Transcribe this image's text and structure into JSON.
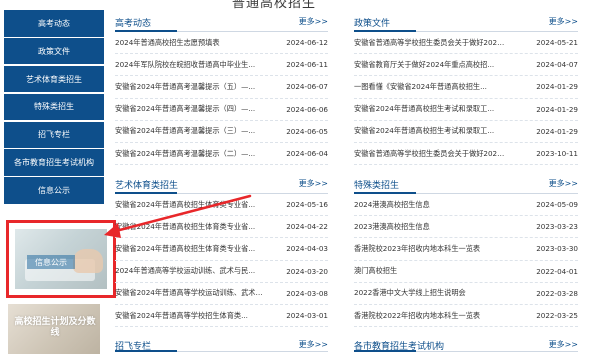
{
  "page_title": "普通高校招生",
  "sidebar": {
    "items": [
      {
        "label": "高考动态"
      },
      {
        "label": "政策文件"
      },
      {
        "label": "艺术体育类招生"
      },
      {
        "label": "特殊类招生"
      },
      {
        "label": "招飞专栏"
      },
      {
        "label": "各市教育招生考试机构"
      },
      {
        "label": "信息公示"
      }
    ],
    "promo1_label": "信息公示",
    "promo2_label": "高校招生计划及分数线"
  },
  "more_label": "更多>>",
  "sections": {
    "gaokao": {
      "title": "高考动态",
      "rows": [
        {
          "title": "2024年普通高校招生志愿预填表",
          "date": "2024-06-12"
        },
        {
          "title": "2024年军队院校在皖招收普通高中毕业生...",
          "date": "2024-06-11"
        },
        {
          "title": "安徽省2024年普通高考温馨提示（五）—...",
          "date": "2024-06-07"
        },
        {
          "title": "安徽省2024年普通高考温馨提示（四）—...",
          "date": "2024-06-06"
        },
        {
          "title": "安徽省2024年普通高考温馨提示（三）—...",
          "date": "2024-06-05"
        },
        {
          "title": "安徽省2024年普通高考温馨提示（二）—...",
          "date": "2024-06-04"
        }
      ]
    },
    "policy": {
      "title": "政策文件",
      "rows": [
        {
          "title": "安徽省普通高等学校招生委员会关于做好2024...",
          "date": "2024-05-21"
        },
        {
          "title": "安徽省教育厅关于做好2024年重点高校招...",
          "date": "2024-04-07"
        },
        {
          "title": "一图看懂《安徽省2024年普通高校招生...",
          "date": "2024-01-29"
        },
        {
          "title": "安徽省2024年普通高校招生考试和录取工...",
          "date": "2024-01-29"
        },
        {
          "title": "安徽省2024年普通高校招生考试和录取工...",
          "date": "2024-01-29"
        },
        {
          "title": "安徽省普通高等学校招生委员会关于做好2024...",
          "date": "2023-10-11"
        }
      ]
    },
    "art": {
      "title": "艺术体育类招生",
      "rows": [
        {
          "title": "安徽省2024年普通高校招生体育类专业省...",
          "date": "2024-05-16"
        },
        {
          "title": "安徽省2024年普通高校招生体育类专业省...",
          "date": "2024-04-22"
        },
        {
          "title": "安徽省2024年普通高校招生体育类专业省...",
          "date": "2024-04-03"
        },
        {
          "title": "2024年普通高等学校运动训练、武术与民...",
          "date": "2024-03-20"
        },
        {
          "title": "安徽省2024年普通高等学校运动训练、武术与民...",
          "date": "2024-03-08"
        },
        {
          "title": "安徽省2024年普通高等学校招生体育类...",
          "date": "2024-03-01"
        }
      ]
    },
    "special": {
      "title": "特殊类招生",
      "rows": [
        {
          "title": "2024港澳高校招生信息",
          "date": "2024-05-09"
        },
        {
          "title": "2023港澳高校招生信息",
          "date": "2023-03-23"
        },
        {
          "title": "香港院校2023年招收内地本科生一览表",
          "date": "2023-03-30"
        },
        {
          "title": "澳门高校招生",
          "date": "2022-04-01"
        },
        {
          "title": "2022香港中文大学线上招生说明会",
          "date": "2022-03-28"
        },
        {
          "title": "香港院校2022年招收内地本科生一览表",
          "date": "2022-03-25"
        }
      ]
    },
    "pilot": {
      "title": "招飞专栏"
    },
    "cities": {
      "title": "各市教育招生考试机构"
    }
  }
}
